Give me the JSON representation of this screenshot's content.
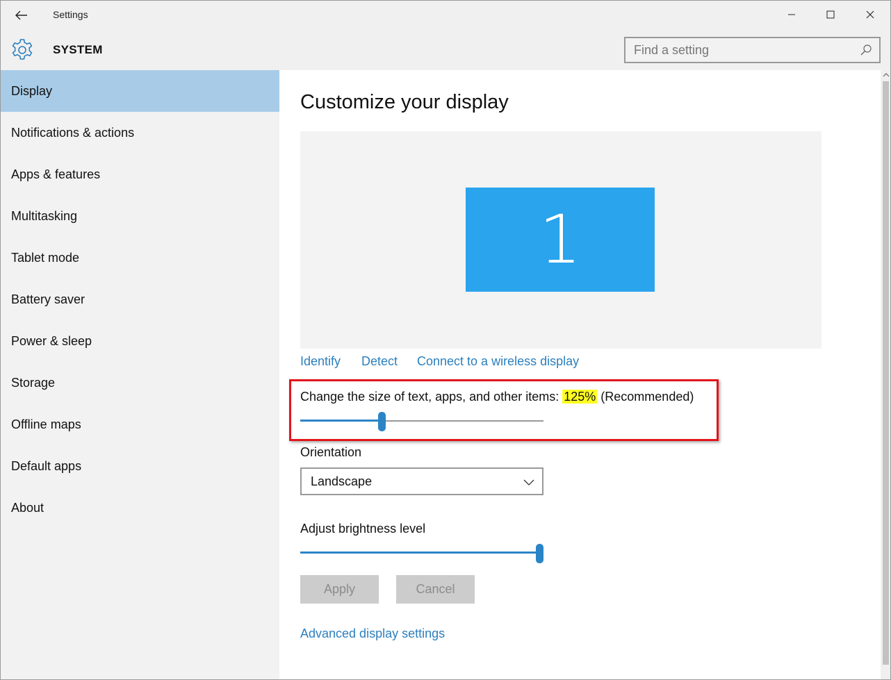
{
  "window": {
    "title": "Settings"
  },
  "header": {
    "section": "SYSTEM",
    "search_placeholder": "Find a setting"
  },
  "sidebar": {
    "items": [
      {
        "label": "Display",
        "active": true
      },
      {
        "label": "Notifications & actions"
      },
      {
        "label": "Apps & features"
      },
      {
        "label": "Multitasking"
      },
      {
        "label": "Tablet mode"
      },
      {
        "label": "Battery saver"
      },
      {
        "label": "Power & sleep"
      },
      {
        "label": "Storage"
      },
      {
        "label": "Offline maps"
      },
      {
        "label": "Default apps"
      },
      {
        "label": "About"
      }
    ]
  },
  "main": {
    "title": "Customize your display",
    "monitor_number": "1",
    "links": {
      "identify": "Identify",
      "detect": "Detect",
      "connect": "Connect to a wireless display"
    },
    "scale": {
      "label": "Change the size of text, apps, and other items:",
      "value": "125%",
      "suffix": "(Recommended)",
      "slider_fraction": 0.33
    },
    "orientation": {
      "label": "Orientation",
      "value": "Landscape"
    },
    "brightness": {
      "label": "Adjust brightness level",
      "slider_fraction": 1.0
    },
    "buttons": {
      "apply": "Apply",
      "cancel": "Cancel"
    },
    "advanced_link": "Advanced display settings"
  },
  "colors": {
    "accent": "#2b84c6",
    "active_nav": "#a8cce8",
    "monitor": "#2aa4ec",
    "highlight_box": "#e3141b",
    "value_highlight": "#ffff20"
  }
}
